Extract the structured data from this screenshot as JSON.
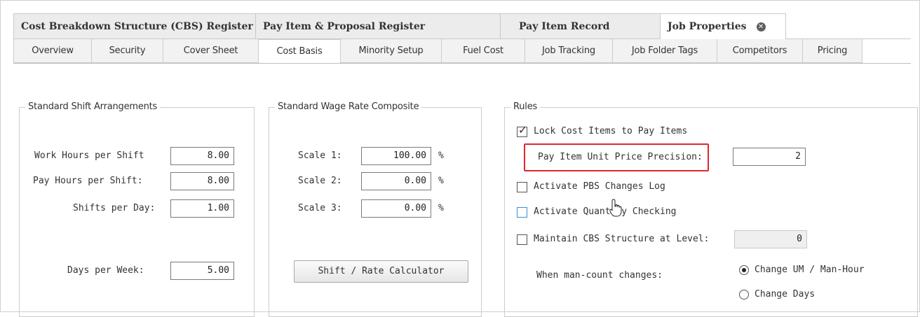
{
  "doc_tabs": [
    {
      "label": "Cost Breakdown Structure (CBS) Register"
    },
    {
      "label": "Pay Item & Proposal Register"
    },
    {
      "label": "Pay Item Record"
    },
    {
      "label": "Job Properties",
      "active": true
    }
  ],
  "sub_tabs": [
    {
      "label": "Overview"
    },
    {
      "label": "Security"
    },
    {
      "label": "Cover Sheet"
    },
    {
      "label": "Cost Basis",
      "active": true
    },
    {
      "label": "Minority Setup"
    },
    {
      "label": "Fuel Cost"
    },
    {
      "label": "Job Tracking"
    },
    {
      "label": "Job Folder Tags"
    },
    {
      "label": "Competitors"
    },
    {
      "label": "Pricing"
    }
  ],
  "shift": {
    "title": "Standard Shift Arrangements",
    "work_hours_label": "Work Hours per Shift",
    "work_hours_value": "8.00",
    "pay_hours_label": "Pay Hours per Shift:",
    "pay_hours_value": "8.00",
    "shifts_per_day_label": "Shifts per Day:",
    "shifts_per_day_value": "1.00",
    "days_per_week_label": "Days per Week:",
    "days_per_week_value": "5.00"
  },
  "wage": {
    "title": "Standard Wage Rate Composite",
    "scale1_label": "Scale 1:",
    "scale1_value": "100.00",
    "scale2_label": "Scale 2:",
    "scale2_value": "0.00",
    "scale3_label": "Scale 3:",
    "scale3_value": "0.00",
    "unit": "%",
    "calculator_button": "Shift / Rate Calculator"
  },
  "rules": {
    "title": "Rules",
    "lock_cost_items_label": "Lock Cost Items to Pay Items",
    "lock_cost_items_checked": true,
    "precision_label": "Pay Item Unit Price Precision:",
    "precision_value": "2",
    "activate_pbs_label": "Activate PBS Changes Log",
    "activate_quantity_label": "Activate Quantity Checking",
    "maintain_cbs_label": "Maintain CBS Structure at Level:",
    "maintain_cbs_value": "0",
    "man_count_label": "When man-count changes:",
    "option_um": "Change UM / Man-Hour",
    "option_days": "Change Days",
    "selected_option": "Change UM / Man-Hour"
  },
  "colors": {
    "highlight": "#e0262b",
    "focus": "#3b8fd8"
  }
}
